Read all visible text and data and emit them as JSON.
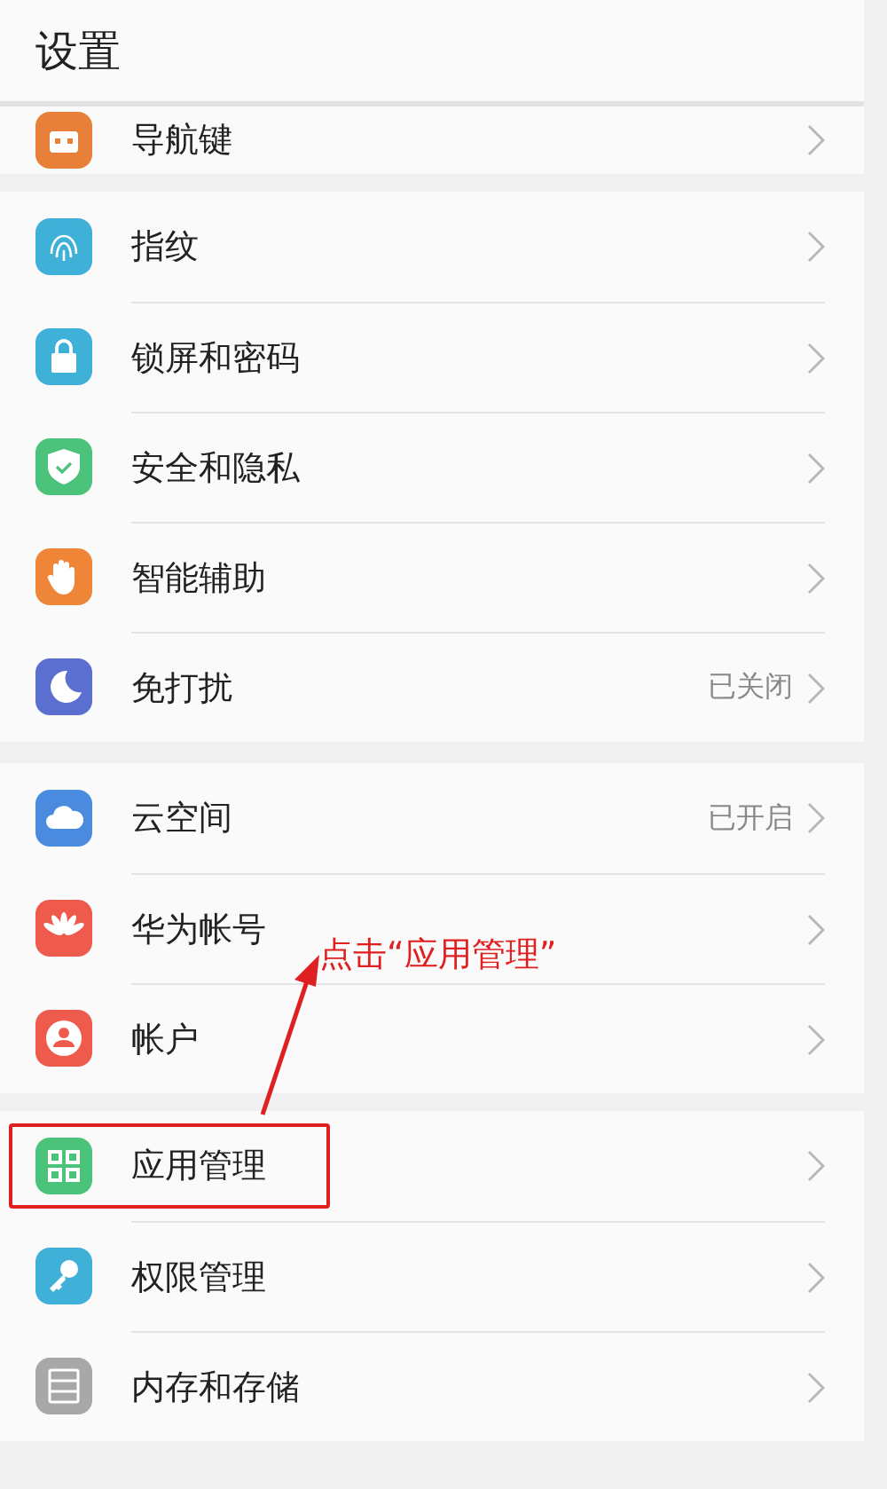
{
  "header": {
    "title": "设置"
  },
  "sections": [
    {
      "items": [
        {
          "kind": "partial",
          "color": "#e8803a",
          "label": "导航键",
          "highlighted": false
        }
      ]
    },
    {
      "items": [
        {
          "kind": "row",
          "color": "#3fb0d8",
          "label": "指纹",
          "highlighted": false
        },
        {
          "kind": "row",
          "color": "#3fb0d8",
          "label": "锁屏和密码",
          "highlighted": false
        },
        {
          "kind": "row",
          "color": "#4cc37a",
          "label": "安全和隐私",
          "highlighted": false
        },
        {
          "kind": "row",
          "color": "#ef8536",
          "label": "智能辅助",
          "highlighted": false
        },
        {
          "kind": "row",
          "color": "#5b6fd0",
          "label": "免打扰",
          "value": "已关闭",
          "highlighted": false
        }
      ]
    },
    {
      "items": [
        {
          "kind": "row",
          "color": "#4a8be0",
          "label": "云空间",
          "value": "已开启",
          "highlighted": false
        },
        {
          "kind": "row",
          "color": "#ee5a4c",
          "label": "华为帐号",
          "highlighted": false
        },
        {
          "kind": "row",
          "color": "#ee5a4c",
          "label": "帐户",
          "highlighted": false
        }
      ]
    },
    {
      "items": [
        {
          "kind": "row",
          "color": "#4cc37a",
          "label": "应用管理",
          "highlighted": true
        },
        {
          "kind": "row",
          "color": "#3fb0d8",
          "label": "权限管理",
          "highlighted": false
        },
        {
          "kind": "row",
          "color": "#a8a8a8",
          "label": "内存和存储",
          "highlighted": false
        }
      ]
    }
  ],
  "callout": {
    "text": "点击“应用管理”"
  }
}
